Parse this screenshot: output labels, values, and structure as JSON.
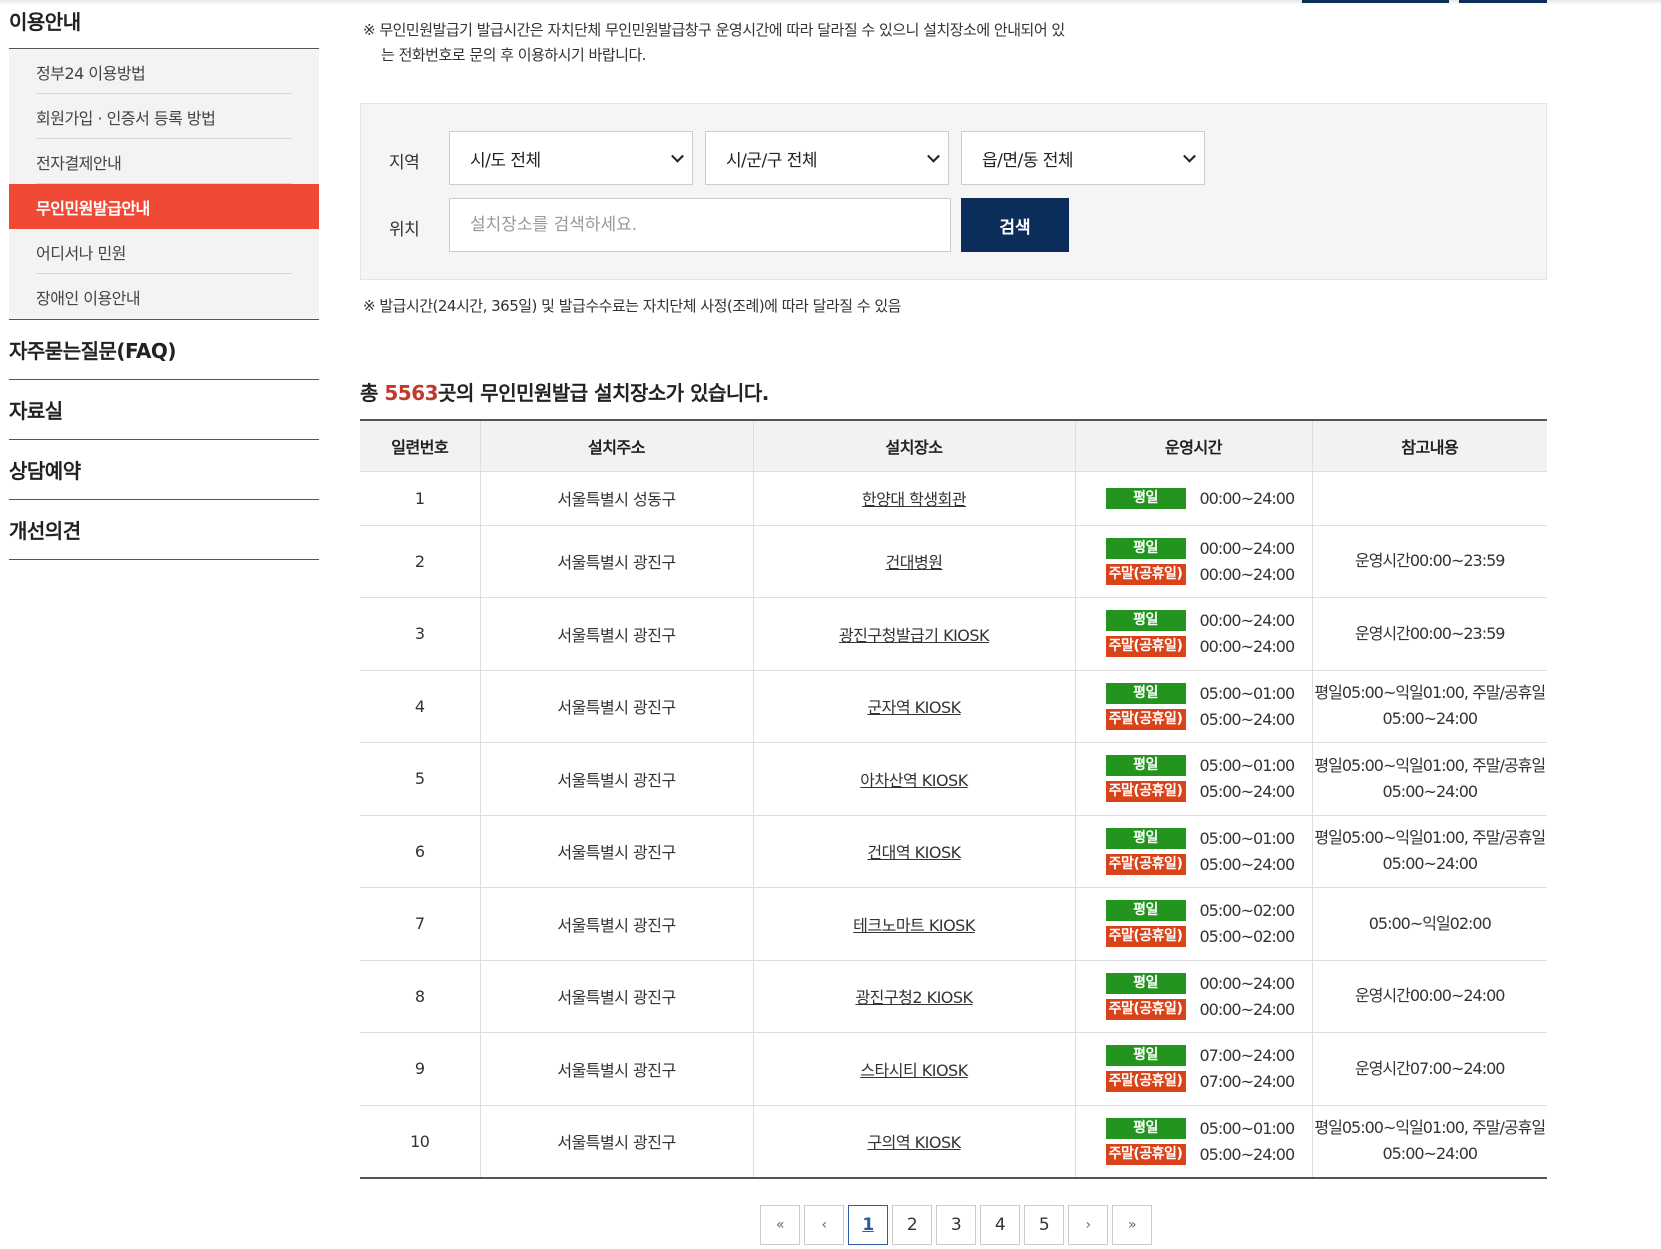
{
  "sidebar": {
    "section_title": "이용안내",
    "sub_items": [
      {
        "label": "정부24 이용방법",
        "active": false
      },
      {
        "label": "회원가입 · 인증서 등록 방법",
        "active": false
      },
      {
        "label": "전자결제안내",
        "active": false
      },
      {
        "label": "무인민원발급안내",
        "active": true
      },
      {
        "label": "어디서나 민원",
        "active": false
      },
      {
        "label": "장애인 이용안내",
        "active": false
      }
    ],
    "menus": [
      "자주묻는질문(FAQ)",
      "자료실",
      "상담예약",
      "개선의견"
    ]
  },
  "notice_top": {
    "line1": "※ 무인민원발급기 발급시간은 자치단체 무인민원발급창구 운영시간에 따라 달라질 수 있으니 설치장소에 안내되어 있",
    "line2": "는 전화번호로 문의 후 이용하시기 바랍니다."
  },
  "search": {
    "region_label": "지역",
    "location_label": "위치",
    "sido": "시/도 전체",
    "sigungu": "시/군/구 전체",
    "eupmyeondong": "읍/면/동 전체",
    "placeholder": "설치장소를 검색하세요.",
    "button": "검색"
  },
  "notice_mid": "※ 발급시간(24시간, 365일) 및 발급수수료는 자치단체 사정(조례)에 따라 달라질 수 있음",
  "total": {
    "prefix": "총 ",
    "count": "5563",
    "suffix": "곳의 무인민원발급 설치장소가 있습니다."
  },
  "table": {
    "headers": [
      "일련번호",
      "설치주소",
      "설치장소",
      "운영시간",
      "참고내용"
    ],
    "weekday_label": "평일",
    "weekend_label": "주말(공휴일)",
    "rows": [
      {
        "no": "1",
        "address": "서울특별시 성동구",
        "place": "한양대 학생회관",
        "weekday": "00:00~24:00",
        "weekend": "",
        "remark": ""
      },
      {
        "no": "2",
        "address": "서울특별시 광진구",
        "place": "건대병원",
        "weekday": "00:00~24:00",
        "weekend": "00:00~24:00",
        "remark": "운영시간00:00~23:59"
      },
      {
        "no": "3",
        "address": "서울특별시 광진구",
        "place": "광진구청발급기 KIOSK",
        "weekday": "00:00~24:00",
        "weekend": "00:00~24:00",
        "remark": "운영시간00:00~23:59"
      },
      {
        "no": "4",
        "address": "서울특별시 광진구",
        "place": "군자역 KIOSK",
        "weekday": "05:00~01:00",
        "weekend": "05:00~24:00",
        "remark": "평일05:00~익일01:00, 주말/공휴일 05:00~24:00"
      },
      {
        "no": "5",
        "address": "서울특별시 광진구",
        "place": "아차산역 KIOSK",
        "weekday": "05:00~01:00",
        "weekend": "05:00~24:00",
        "remark": "평일05:00~익일01:00, 주말/공휴일 05:00~24:00"
      },
      {
        "no": "6",
        "address": "서울특별시 광진구",
        "place": "건대역 KIOSK",
        "weekday": "05:00~01:00",
        "weekend": "05:00~24:00",
        "remark": "평일05:00~익일01:00, 주말/공휴일 05:00~24:00"
      },
      {
        "no": "7",
        "address": "서울특별시 광진구",
        "place": "테크노마트 KIOSK",
        "weekday": "05:00~02:00",
        "weekend": "05:00~02:00",
        "remark": "05:00~익일02:00"
      },
      {
        "no": "8",
        "address": "서울특별시 광진구",
        "place": "광진구청2 KIOSK",
        "weekday": "00:00~24:00",
        "weekend": "00:00~24:00",
        "remark": "운영시간00:00~24:00"
      },
      {
        "no": "9",
        "address": "서울특별시 광진구",
        "place": "스타시티 KIOSK",
        "weekday": "07:00~24:00",
        "weekend": "07:00~24:00",
        "remark": "운영시간07:00~24:00"
      },
      {
        "no": "10",
        "address": "서울특별시 광진구",
        "place": "구의역 KIOSK",
        "weekday": "05:00~01:00",
        "weekend": "05:00~24:00",
        "remark": "평일05:00~익일01:00, 주말/공휴일 05:00~24:00"
      }
    ]
  },
  "pagination": {
    "first": "«",
    "prev": "‹",
    "next": "›",
    "last": "»",
    "pages": [
      "1",
      "2",
      "3",
      "4",
      "5"
    ],
    "current": "1"
  },
  "colors": {
    "accent": "#f04a36",
    "navy": "#0b2d59",
    "weekday": "#23951f",
    "weekend": "#d9431a",
    "count": "#c0392b"
  }
}
